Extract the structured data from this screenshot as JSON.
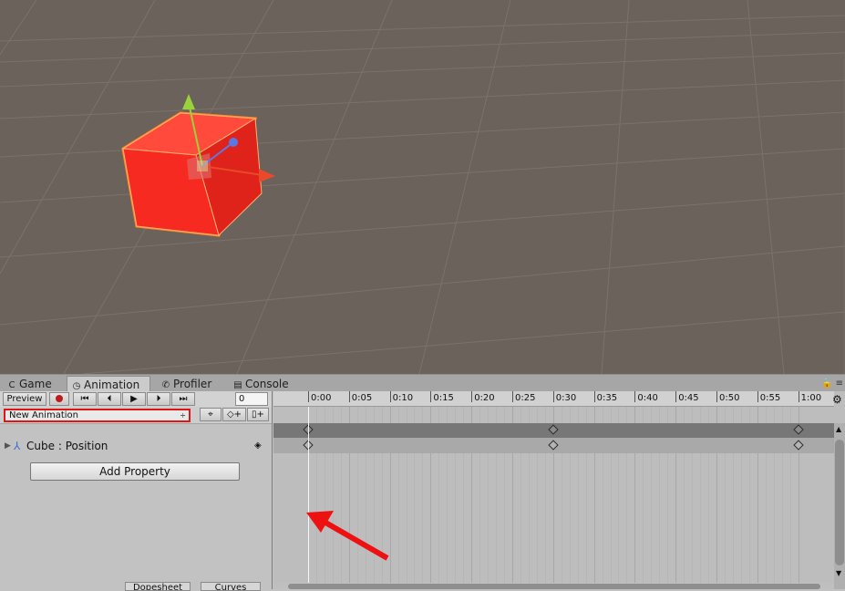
{
  "tabs": [
    {
      "icon": "game-icon",
      "glyph": "C",
      "label": "Game"
    },
    {
      "icon": "clock-icon",
      "glyph": "◷",
      "label": "Animation"
    },
    {
      "icon": "profiler-icon",
      "glyph": "✆",
      "label": "Profiler"
    },
    {
      "icon": "console-icon",
      "glyph": "▤",
      "label": "Console"
    }
  ],
  "toolbar": {
    "preview_label": "Preview",
    "frame_value": "0"
  },
  "clip": {
    "name": "New Animation",
    "arrow": "÷"
  },
  "properties": [
    {
      "object": "Cube",
      "separator": ":",
      "name": "Position"
    }
  ],
  "add_property_label": "Add Property",
  "bottom_tabs": {
    "dopesheet": "Dopesheet",
    "curves": "Curves"
  },
  "ruler": {
    "labels": [
      "0:00",
      "0:05",
      "0:10",
      "0:15",
      "0:20",
      "0:25",
      "0:30",
      "0:35",
      "0:40",
      "0:45",
      "0:50",
      "0:55",
      "1:00"
    ]
  },
  "keyframes_at": [
    "0:00",
    "0:30",
    "1:00"
  ],
  "colors": {
    "scene_bg": "#6b625b",
    "cube_selected": "#ff2e20",
    "record_red": "#c01a1a",
    "highlight_red": "#e01616"
  }
}
